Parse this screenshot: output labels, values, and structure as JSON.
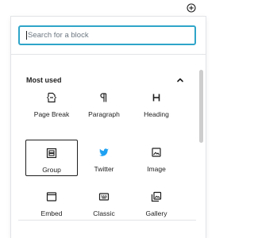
{
  "search": {
    "placeholder": "Search for a block"
  },
  "panel": {
    "title": "Most used"
  },
  "blocks": [
    {
      "label": "Page Break",
      "icon": "page-break-icon",
      "selected": false
    },
    {
      "label": "Paragraph",
      "icon": "paragraph-icon",
      "selected": false
    },
    {
      "label": "Heading",
      "icon": "heading-icon",
      "selected": false
    },
    {
      "label": "Group",
      "icon": "group-icon",
      "selected": true
    },
    {
      "label": "Twitter",
      "icon": "twitter-icon",
      "selected": false
    },
    {
      "label": "Image",
      "icon": "image-icon",
      "selected": false
    },
    {
      "label": "Embed",
      "icon": "embed-icon",
      "selected": false
    },
    {
      "label": "Classic",
      "icon": "classic-icon",
      "selected": false
    },
    {
      "label": "Gallery",
      "icon": "gallery-icon",
      "selected": false
    }
  ],
  "colors": {
    "focus_border": "#2fa5c9",
    "twitter_blue": "#1da1f2",
    "text": "#1e1e1e",
    "divider": "#e2e4e7"
  }
}
